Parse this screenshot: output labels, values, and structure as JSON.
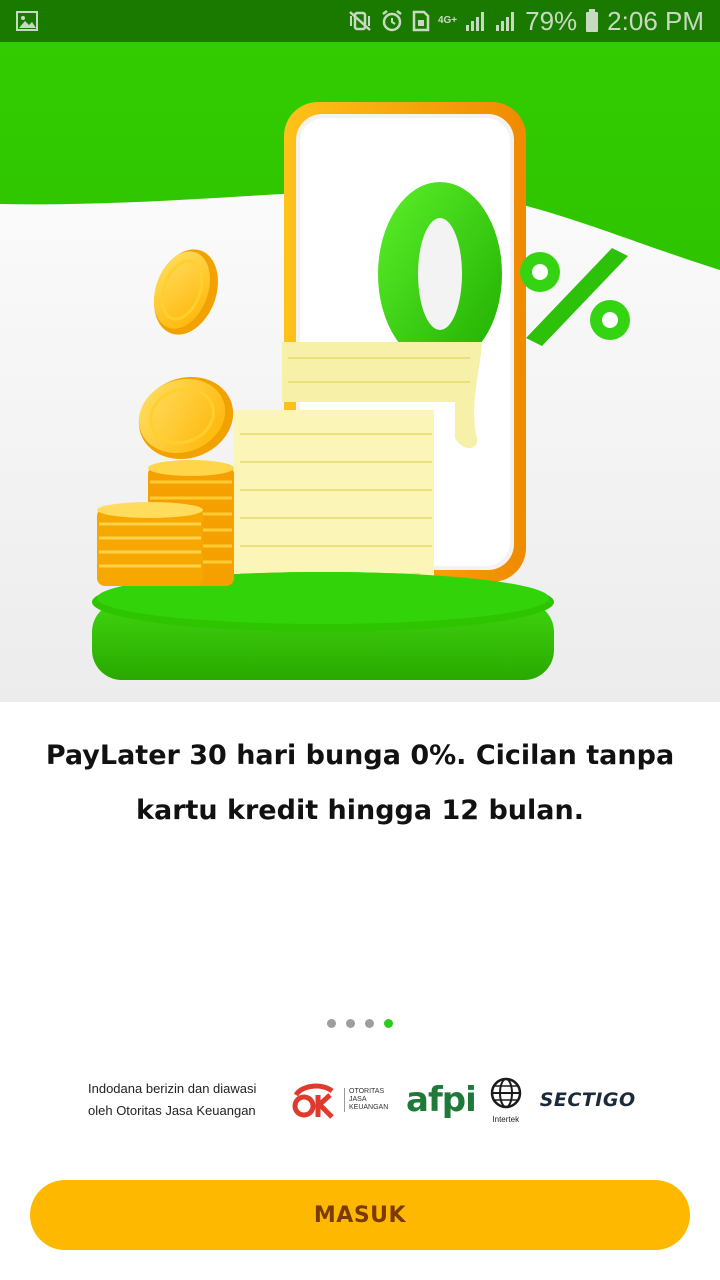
{
  "status_bar": {
    "network": "4G+",
    "battery_percent": "79%",
    "time": "2:06 PM"
  },
  "hero": {
    "percent_badge": "0%"
  },
  "headline": "PayLater 30 hari bunga 0%. Cicilan tanpa kartu kredit hingga 12 bulan.",
  "pager": {
    "total": 4,
    "active_index": 3
  },
  "regulation": {
    "text": "Indodana berizin dan diawasi oleh Otoritas Jasa Keuangan",
    "ojk_logo_text": "OJK",
    "ojk_caption": "OTORITAS JASA KEUANGAN",
    "afpi_logo_text": "afpi",
    "intertek_logo_text": "Intertek",
    "sectigo_logo_text": "SECTIGO"
  },
  "login_button": "MASUK",
  "colors": {
    "brand_green": "#2ecc1a",
    "status_bar": "#1a7a00",
    "button_yellow": "#ffb800",
    "button_text": "#7a3b00"
  }
}
